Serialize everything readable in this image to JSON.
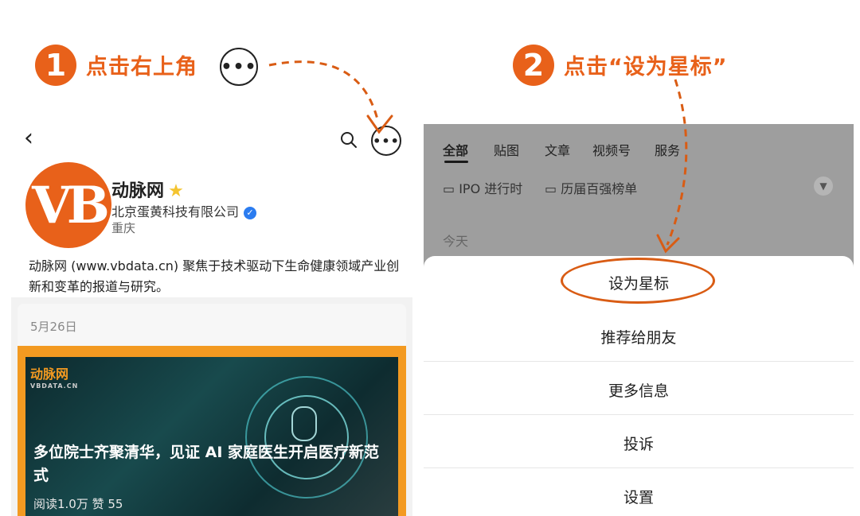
{
  "step1": {
    "number": "1",
    "text": "点击右上角",
    "dots": "•••"
  },
  "step2": {
    "number": "2",
    "text": "点击“设为星标”"
  },
  "left": {
    "back": "‹",
    "search_icon": "search-icon",
    "more_dots": "•••",
    "avatar_text": "VB",
    "name": "动脉网",
    "company": "北京蛋黄科技有限公司",
    "verified_mark": "✓",
    "city": "重庆",
    "description": "动脉网 (www.vbdata.cn) 聚焦于技术驱动下生命健康领域产业创新和变革的报道与研究。",
    "post_date": "5月26日",
    "article": {
      "logo": "动脉网",
      "logo_sub": "VBDATA.CN",
      "title": "多位院士齐聚清华，见证 AI 家庭医生开启医疗新范式",
      "meta": "阅读1.0万  赞 55"
    }
  },
  "right": {
    "tabs": [
      "全部",
      "贴图",
      "文章",
      "视频号",
      "服务"
    ],
    "chips": [
      "IPO 进行时",
      "历届百强榜单"
    ],
    "today": "今天",
    "menu": [
      "设为星标",
      "推荐给朋友",
      "更多信息",
      "投诉",
      "设置"
    ]
  },
  "colors": {
    "accent": "#e8611a",
    "overlay": "#9e9e9e",
    "verified": "#2b7cf0",
    "star": "#f4c430"
  }
}
